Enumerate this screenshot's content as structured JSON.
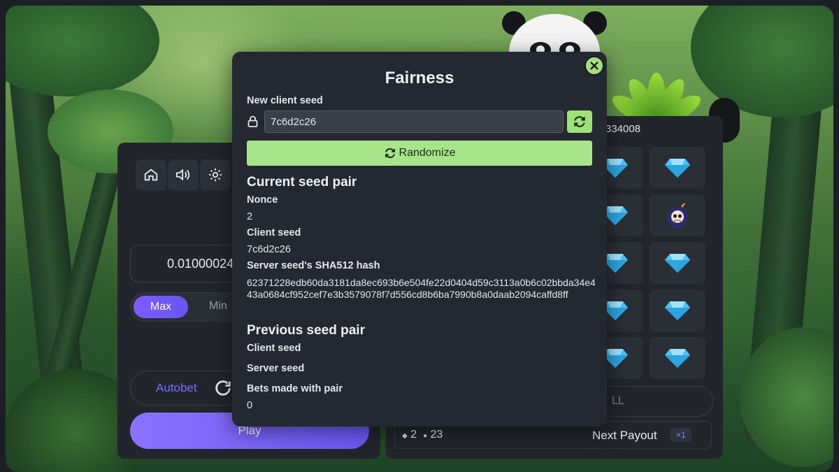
{
  "game": {
    "hash_suffix": "334008",
    "left_panel": {
      "bet_amount": "0.01000024",
      "max_label": "Max",
      "min_label": "Min",
      "autobet_label": "Autobet",
      "play_label": "Play"
    },
    "board": {
      "cashout_label_fragment": "LL",
      "gems_count": "2",
      "mines_count": "23",
      "next_payout_label": "Next Payout",
      "multiplier": "×1",
      "tiles": [
        "gem-icon",
        "gem-icon",
        "gem-icon",
        "bomb-skull-icon",
        "gem-icon",
        "gem-icon",
        "gem-icon",
        "gem-icon",
        "gem-icon",
        "gem-icon"
      ]
    },
    "icons": [
      "home-icon",
      "volume-icon",
      "gear-icon",
      "refresh-icon",
      "lock-icon",
      "close-icon"
    ]
  },
  "fairness_modal": {
    "title": "Fairness",
    "new_client_seed_label": "New client seed",
    "new_client_seed_value": "7c6d2c26",
    "randomize_label": "Randomize",
    "current_seed_pair_heading": "Current seed pair",
    "nonce_label": "Nonce",
    "nonce_value": "2",
    "client_seed_label": "Client seed",
    "client_seed_value": "7c6d2c26",
    "server_hash_label": "Server seed's SHA512 hash",
    "server_hash_value": "62371228edb60da3181da8ec693b6e504fe22d0404d59c3113a0b6c02bbda34e443a0684cf952cef7e3b3579078f7d556cd8b6ba7990b8a0daab2094caffd8ff",
    "previous_seed_pair_heading": "Previous seed pair",
    "prev_client_seed_label": "Client seed",
    "prev_server_seed_label": "Server seed",
    "bets_made_label": "Bets made with pair",
    "bets_made_value": "0"
  },
  "colors": {
    "accent_purple": "#7b5cff",
    "accent_green": "#a8e48a",
    "panel": "#22262c",
    "modal": "#242830",
    "gem": "#4fc3f7"
  }
}
